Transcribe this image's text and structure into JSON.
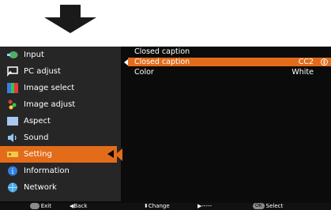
{
  "colors": {
    "accent": "#e36c1a",
    "sidebar": "#262626",
    "panel": "#0b0b0b"
  },
  "sidebar": {
    "items": [
      {
        "label": "Input",
        "icon": "input-icon",
        "selected": false
      },
      {
        "label": "PC adjust",
        "icon": "pc-adjust-icon",
        "selected": false
      },
      {
        "label": "Image select",
        "icon": "image-select-icon",
        "selected": false
      },
      {
        "label": "Image adjust",
        "icon": "image-adjust-icon",
        "selected": false
      },
      {
        "label": "Aspect",
        "icon": "aspect-icon",
        "selected": false
      },
      {
        "label": "Sound",
        "icon": "sound-icon",
        "selected": false
      },
      {
        "label": "Setting",
        "icon": "setting-icon",
        "selected": true
      },
      {
        "label": "Information",
        "icon": "information-icon",
        "selected": false
      },
      {
        "label": "Network",
        "icon": "network-icon",
        "selected": false
      }
    ]
  },
  "panel": {
    "title": "Closed caption",
    "rows": [
      {
        "name": "Closed caption",
        "value": "CC2",
        "selected": true
      },
      {
        "name": "Color",
        "value": "White",
        "selected": false
      }
    ]
  },
  "footer": {
    "exit_badge": "",
    "exit": "Exit",
    "back": "◀Back",
    "change": "⬍Change",
    "next": "▶-----",
    "select_badge": "OK",
    "select": "Select"
  }
}
